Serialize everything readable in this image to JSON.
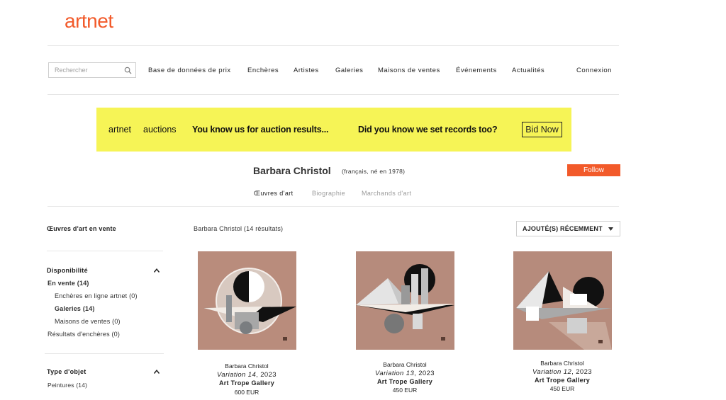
{
  "header": {
    "logo": "artnet",
    "search_placeholder": "Rechercher",
    "nav": [
      "Base de données de prix",
      "Enchères",
      "Artistes",
      "Galeries",
      "Maisons de ventes",
      "Événements",
      "Actualités"
    ],
    "login": "Connexion"
  },
  "banner": {
    "brand": "artnet",
    "brand2": "auctions",
    "text1": "You know us for auction results...",
    "text2": "Did you know we set records too?",
    "cta": "Bid Now"
  },
  "artist": {
    "name": "Barbara Christol",
    "meta": "(français, né en 1978)",
    "follow": "Follow"
  },
  "tabs": [
    "Œuvres d'art",
    "Biographie",
    "Marchands d'art"
  ],
  "sidebar": {
    "title": "Œuvres d'art en vente",
    "availability": {
      "heading": "Disponibilité",
      "items": [
        "En vente (14)",
        "Enchères en ligne artnet (0)",
        "Galeries (14)",
        "Maisons de ventes (0)",
        "Résultats d'enchères (0)"
      ]
    },
    "object_type": {
      "heading": "Type d'objet",
      "items": [
        "Peintures (14)"
      ]
    }
  },
  "results": {
    "count": "Barbara Christol (14 résultats)",
    "sort": "AJOUTÉ(S) RÉCEMMENT"
  },
  "artworks": [
    {
      "artist": "Barbara Christol",
      "title": "Variation 14",
      "year": ", 2023",
      "gallery": "Art Trope Gallery",
      "price": "600 EUR"
    },
    {
      "artist": "Barbara Christol",
      "title": "Variation 13",
      "year": ", 2023",
      "gallery": "Art Trope Gallery",
      "price": "450 EUR"
    },
    {
      "artist": "Barbara Christol",
      "title": "Variation 12",
      "year": ", 2023",
      "gallery": "Art Trope Gallery",
      "price": "450 EUR"
    }
  ],
  "colors": {
    "brand": "#f25a2a",
    "banner_bg": "#f6f456",
    "canvas": "#b78b7b",
    "tab_inactive": "#9a9a9a"
  }
}
